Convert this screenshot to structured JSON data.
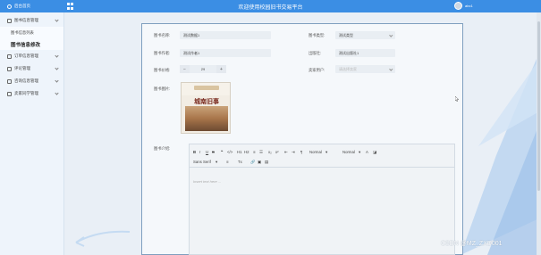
{
  "header": {
    "home_label": "后台首页",
    "title": "欢迎使用校园旧书交易平台",
    "username": "abc1"
  },
  "sidebar": {
    "items": [
      {
        "label": "图书信息管理",
        "icon": "book-icon",
        "expanded": true,
        "children": [
          {
            "label": "图书信息列表",
            "active": false
          },
          {
            "label": "图书信息修改",
            "active": true
          }
        ]
      },
      {
        "label": "订单信息管理",
        "icon": "order-icon"
      },
      {
        "label": "评论管理",
        "icon": "comment-icon"
      },
      {
        "label": "咨询信息管理",
        "icon": "chat-icon"
      },
      {
        "label": "卖家同学管理",
        "icon": "user-icon"
      }
    ]
  },
  "form": {
    "name_label": "图书名称:",
    "name_value": "测试数据1",
    "type_label": "图书类型:",
    "type_value": "测试类型",
    "author_label": "图书作者:",
    "author_value": "测试作者1",
    "publisher_label": "出版社:",
    "publisher_value": "测试出版社1",
    "price_label": "图书价格:",
    "price_value": "29",
    "seller_label": "卖家用户:",
    "seller_placeholder": "请选择卖家",
    "cover_label": "图书图片:",
    "cover_title": "城南旧事",
    "intro_label": "图书介绍:"
  },
  "editor": {
    "toolbar_row1": [
      "B",
      "I",
      "U",
      "S",
      "❝",
      "</>",
      "H1",
      "H2",
      "≡",
      "☰",
      "x₂",
      "x²",
      "⇤",
      "⇥",
      "¶",
      "Normal",
      "▾",
      "Normal",
      "▾",
      "A",
      "◪"
    ],
    "font_select": "Sans Serif",
    "toolbar_row2_extra": [
      "≡",
      "Tx",
      "🔗",
      "▣",
      "▤"
    ],
    "placeholder": "Insert text here ..."
  },
  "watermark": "CSDN @MZ_ZXD001",
  "colors": {
    "header": "#3b8ee4",
    "sidebar": "#eef4fb",
    "panel_border": "#7f9fbf",
    "deco_blue": "#b9d3f0"
  }
}
